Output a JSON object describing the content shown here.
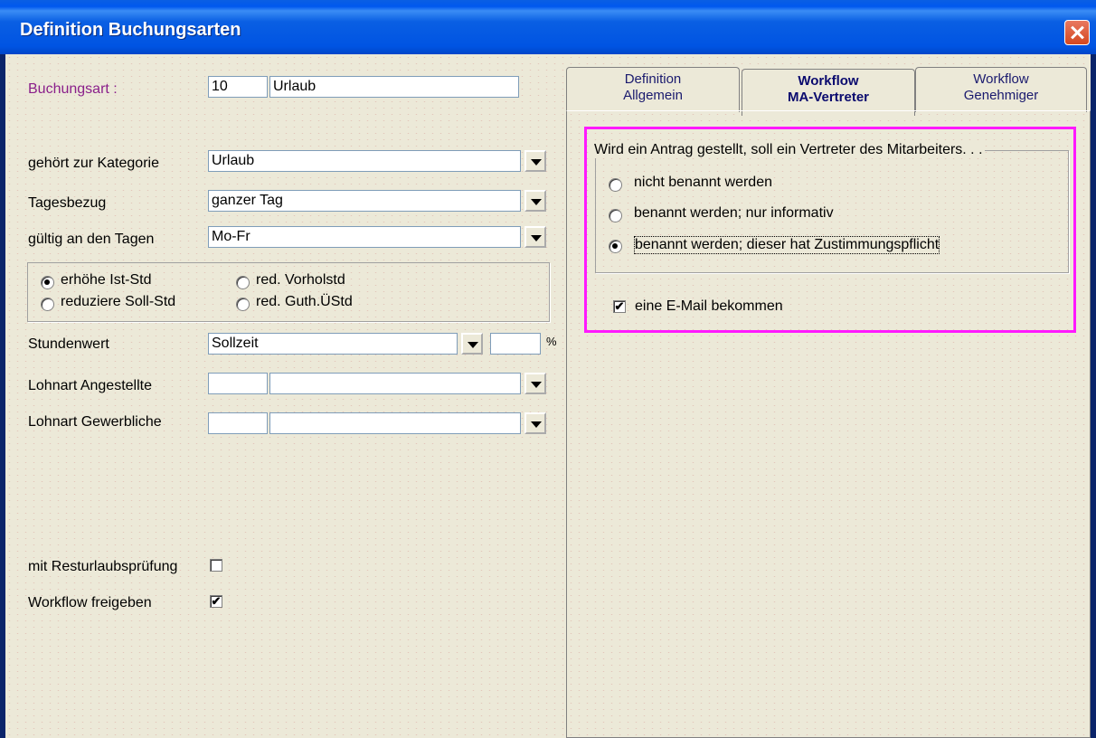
{
  "window": {
    "title": "Definition Buchungsarten"
  },
  "buchungsart": {
    "label": "Buchungsart :",
    "number": "10",
    "name": "Urlaub",
    "label_color": "#8a1f8a"
  },
  "kategorie": {
    "label": "gehört zur Kategorie",
    "value": "Urlaub"
  },
  "tagesbezug": {
    "label": "Tagesbezug",
    "value": "ganzer Tag"
  },
  "gueltig": {
    "label": "gültig an den Tagen",
    "value": "Mo-Fr"
  },
  "options": {
    "erhoehe": "erhöhe Ist-Std",
    "reduziere": "reduziere Soll-Std",
    "vorholstd": "red. Vorholstd",
    "guth": "red. Guth.ÜStd"
  },
  "stundenwert": {
    "label": "Stundenwert",
    "value": "Sollzeit",
    "percent_value": "",
    "percent_sign": "%"
  },
  "lohnart_ang": {
    "label": "Lohnart Angestellte",
    "code": "",
    "value": ""
  },
  "lohnart_gew": {
    "label": "Lohnart Gewerbliche",
    "code": "",
    "value": ""
  },
  "resturlaub": {
    "label": "mit Resturlaubsprüfung",
    "checked": false
  },
  "workflow": {
    "label": "Workflow freigeben",
    "checked": true
  },
  "tabs": [
    {
      "line1": "Definition",
      "line2": "Allgemein"
    },
    {
      "line1": "Workflow",
      "line2": "MA-Vertreter"
    },
    {
      "line1": "Workflow",
      "line2": "Genehmiger"
    }
  ],
  "vertreter": {
    "legend": "Wird ein Antrag gestellt, soll ein Vertreter des Mitarbeiters. . .",
    "opt1": "nicht benannt werden",
    "opt2": "benannt werden; nur informativ",
    "opt3": "benannt werden; dieser hat Zustimmungspflicht",
    "email_label": "eine E-Mail bekommen",
    "email_checked": true,
    "highlight_color": "#ff19ff"
  },
  "check_mark": "✔"
}
